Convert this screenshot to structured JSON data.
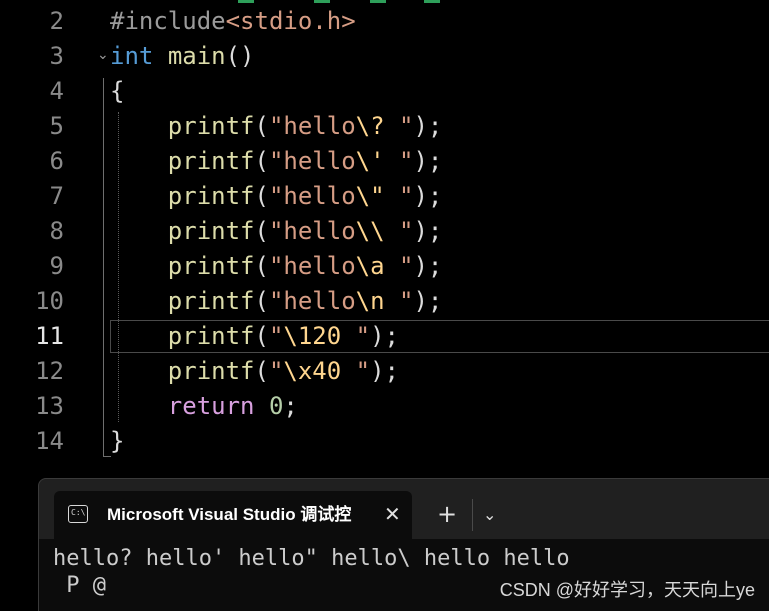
{
  "editor": {
    "lines": [
      {
        "num": "2",
        "tokens": [
          {
            "t": "#include",
            "c": "pre"
          },
          {
            "t": "<stdio.h>",
            "c": "inc"
          }
        ]
      },
      {
        "num": "3",
        "tokens": [
          {
            "t": "int",
            "c": "kw"
          },
          {
            "t": " ",
            "c": ""
          },
          {
            "t": "main",
            "c": "fn"
          },
          {
            "t": "()",
            "c": ""
          }
        ]
      },
      {
        "num": "4",
        "tokens": [
          {
            "t": "{",
            "c": ""
          }
        ]
      },
      {
        "num": "5",
        "tokens": [
          {
            "t": "    ",
            "c": ""
          },
          {
            "t": "printf",
            "c": "fn"
          },
          {
            "t": "(",
            "c": ""
          },
          {
            "t": "\"hello",
            "c": "str"
          },
          {
            "t": "\\?",
            "c": "esc"
          },
          {
            "t": " \"",
            "c": "str"
          },
          {
            "t": ");",
            "c": ""
          }
        ]
      },
      {
        "num": "6",
        "tokens": [
          {
            "t": "    ",
            "c": ""
          },
          {
            "t": "printf",
            "c": "fn"
          },
          {
            "t": "(",
            "c": ""
          },
          {
            "t": "\"hello",
            "c": "str"
          },
          {
            "t": "\\'",
            "c": "esc"
          },
          {
            "t": " \"",
            "c": "str"
          },
          {
            "t": ");",
            "c": ""
          }
        ]
      },
      {
        "num": "7",
        "tokens": [
          {
            "t": "    ",
            "c": ""
          },
          {
            "t": "printf",
            "c": "fn"
          },
          {
            "t": "(",
            "c": ""
          },
          {
            "t": "\"hello",
            "c": "str"
          },
          {
            "t": "\\\"",
            "c": "esc"
          },
          {
            "t": " \"",
            "c": "str"
          },
          {
            "t": ");",
            "c": ""
          }
        ]
      },
      {
        "num": "8",
        "tokens": [
          {
            "t": "    ",
            "c": ""
          },
          {
            "t": "printf",
            "c": "fn"
          },
          {
            "t": "(",
            "c": ""
          },
          {
            "t": "\"hello",
            "c": "str"
          },
          {
            "t": "\\\\",
            "c": "esc"
          },
          {
            "t": " \"",
            "c": "str"
          },
          {
            "t": ");",
            "c": ""
          }
        ]
      },
      {
        "num": "9",
        "tokens": [
          {
            "t": "    ",
            "c": ""
          },
          {
            "t": "printf",
            "c": "fn"
          },
          {
            "t": "(",
            "c": ""
          },
          {
            "t": "\"hello",
            "c": "str"
          },
          {
            "t": "\\a",
            "c": "esc"
          },
          {
            "t": " \"",
            "c": "str"
          },
          {
            "t": ");",
            "c": ""
          }
        ]
      },
      {
        "num": "10",
        "tokens": [
          {
            "t": "    ",
            "c": ""
          },
          {
            "t": "printf",
            "c": "fn"
          },
          {
            "t": "(",
            "c": ""
          },
          {
            "t": "\"hello",
            "c": "str"
          },
          {
            "t": "\\n",
            "c": "esc"
          },
          {
            "t": " \"",
            "c": "str"
          },
          {
            "t": ");",
            "c": ""
          }
        ]
      },
      {
        "num": "11",
        "active": true,
        "tokens": [
          {
            "t": "    ",
            "c": ""
          },
          {
            "t": "printf",
            "c": "fn"
          },
          {
            "t": "(",
            "c": ""
          },
          {
            "t": "\"",
            "c": "str"
          },
          {
            "t": "\\120",
            "c": "esc"
          },
          {
            "t": " \"",
            "c": "str"
          },
          {
            "t": ");",
            "c": ""
          }
        ]
      },
      {
        "num": "12",
        "tokens": [
          {
            "t": "    ",
            "c": ""
          },
          {
            "t": "printf",
            "c": "fn"
          },
          {
            "t": "(",
            "c": ""
          },
          {
            "t": "\"",
            "c": "str"
          },
          {
            "t": "\\x40",
            "c": "esc"
          },
          {
            "t": " \"",
            "c": "str"
          },
          {
            "t": ");",
            "c": ""
          }
        ]
      },
      {
        "num": "13",
        "tokens": [
          {
            "t": "    ",
            "c": ""
          },
          {
            "t": "return",
            "c": "ctl"
          },
          {
            "t": " ",
            "c": ""
          },
          {
            "t": "0",
            "c": "num"
          },
          {
            "t": ";",
            "c": ""
          }
        ]
      },
      {
        "num": "14",
        "tokens": [
          {
            "t": "}",
            "c": ""
          }
        ]
      }
    ]
  },
  "console": {
    "tab_title": "Microsoft Visual Studio 调试控",
    "tab_icon_label": "C:\\",
    "close_glyph": "✕",
    "new_tab_glyph": "+",
    "dropdown_glyph": "⌄",
    "output": [
      "hello? hello' hello\" hello\\ hello hello",
      " P @"
    ]
  },
  "watermark": "CSDN @好好学习，天天向上ye",
  "colors": {
    "background": "#000000",
    "keyword": "#569cd6",
    "function": "#dcdcaa",
    "string": "#d69d85",
    "escape": "#ffd68f",
    "control": "#d8a0df",
    "number": "#b5cea8",
    "console_bg": "#0c0c0c",
    "titlebar_bg": "#202020"
  }
}
